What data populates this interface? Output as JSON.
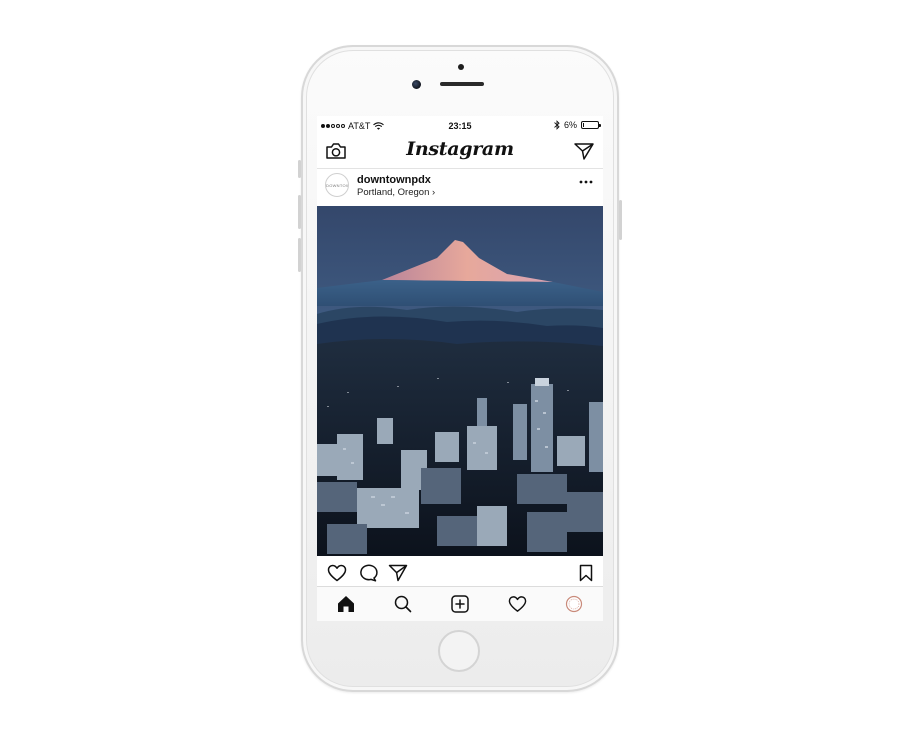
{
  "status_bar": {
    "carrier": "AT&T",
    "time": "23:15",
    "battery": "6%",
    "battery_level": 0.06
  },
  "nav": {
    "logo": "Instagram",
    "left_icon": "camera-icon",
    "right_icon": "direct-send-icon"
  },
  "post": {
    "username": "downtownpdx",
    "location": "Portland, Oregon",
    "location_chevron": "›",
    "avatar_text": "DOWNTOWN",
    "more_icon": "more-options-icon",
    "image_subject": "Mount Hood over downtown Portland at dusk"
  },
  "actions": {
    "icons": [
      "heart-icon",
      "comment-icon",
      "share-icon",
      "bookmark-icon"
    ]
  },
  "tabbar": {
    "icons": [
      "home-icon",
      "search-icon",
      "new-post-icon",
      "activity-heart-icon",
      "profile-avatar-icon"
    ],
    "active": "home-icon"
  },
  "colors": {
    "profile_ring": "#c98a7a",
    "divider": "#dcdcdc"
  }
}
